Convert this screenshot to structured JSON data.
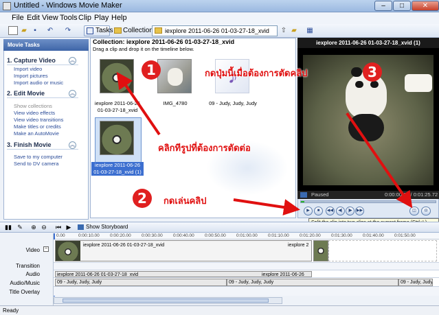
{
  "window": {
    "title": "Untitled - Windows Movie Maker",
    "min": "–",
    "max": "□",
    "close": "✕"
  },
  "menu": [
    "File",
    "Edit",
    "View",
    "Tools",
    "Clip",
    "Play",
    "Help"
  ],
  "toolbar": {
    "tasks_label": "Tasks",
    "collections_label": "Collections",
    "collection_value": "iexplore 2011-06-26 01-03-27-18_xvid"
  },
  "tasks": {
    "header": "Movie Tasks",
    "sections": [
      {
        "title": "1. Capture Video",
        "items": [
          "Import video",
          "Import pictures",
          "Import audio or music"
        ]
      },
      {
        "title": "2. Edit Movie",
        "items": [
          "Show collections",
          "View video effects",
          "View video transitions",
          "Make titles or credits",
          "Make an AutoMovie"
        ]
      },
      {
        "title": "3. Finish Movie",
        "items": [
          "Save to my computer",
          "Send to DV camera"
        ]
      }
    ]
  },
  "collection": {
    "title": "Collection: iexplore 2011-06-26 01-03-27-18_xvid",
    "subtitle": "Drag a clip and drop it on the timeline below.",
    "clips": [
      {
        "caption1": "iexplore 2011-06-26",
        "caption2": "01-03-27-18_xvid"
      },
      {
        "caption1": "IMG_4780",
        "caption2": ""
      },
      {
        "caption1": "09 - Judy, Judy, Judy",
        "caption2": ""
      },
      {
        "caption1": "iexplore 2011-06-26",
        "caption2": "01-03-27-18_xvid (1)"
      }
    ]
  },
  "preview": {
    "title": "iexplore 2011-06-26 01-03-27-18_xvid (1)",
    "status": "Paused",
    "time": "0:00:00.10 / 0:01:25.72",
    "tooltip": "Split the clip into two clips at the current frame (Ctrl+L)",
    "split_icon": "split-icon",
    "snapshot_icon": "camera-icon"
  },
  "timeline": {
    "storyboard_label": "Show Storyboard",
    "ticks": [
      "0.00",
      "0:00:10.00",
      "0:00:20.00",
      "0:00:30.00",
      "0:00:40.00",
      "0:00:50.00",
      "0:01:00.00",
      "0:01:10.00",
      "0:01:20.00",
      "0:01:30.00",
      "0:01:40.00",
      "0:01:50.00"
    ],
    "labels": {
      "video": "Video",
      "transition": "Transition",
      "audio": "Audio",
      "music": "Audio/Music",
      "overlay": "Title Overlay"
    },
    "video_clip": "iexplore 2011-06-26 01-03-27-18_xvid",
    "video_clip_tail": "iexplore 2",
    "audio_clip": "iexplore 2011-06-26 01-03-27-18_xvid",
    "audio_clip_tail": "iexplore 2011-06-26",
    "music_clip": "09 - Judy, Judy, Judy"
  },
  "status": "Ready",
  "annotations": {
    "n1": "1",
    "n2": "2",
    "n3": "3",
    "text1": "คลิกทีรูปที่ต้องการตัดต่อ",
    "text2": "กดเล่นคลิป",
    "text3": "กดปุ่มนี้เมื่อต้องการตัดคลิป"
  }
}
